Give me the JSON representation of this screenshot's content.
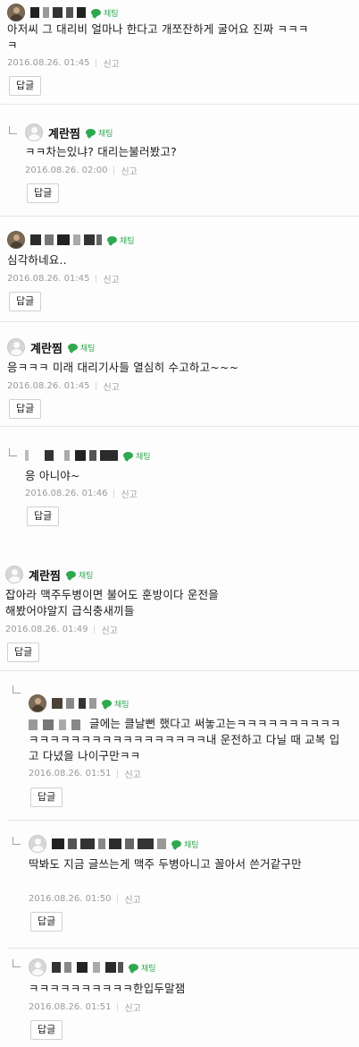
{
  "ui": {
    "chat_label": "채팅",
    "report_label": "신고",
    "reply_label": "답글"
  },
  "comments": [
    {
      "author": "",
      "text": "아저씨 그 대리비 얼마나 한다고 개쪼잔하게 굴어요 진짜 ㅋㅋㅋㅋ",
      "date": "2016.08.26. 01:45"
    },
    {
      "author": "계란찜",
      "text": "ㅋㅋ차는있냐? 대리는불러봤고?",
      "date": "2016.08.26. 02:00"
    },
    {
      "author": "",
      "text": "심각하네요..",
      "date": "2016.08.26. 01:45"
    },
    {
      "author": "계란찜",
      "text": "응ㅋㅋㅋ 미래 대리기사들 열심히 수고하고~~~",
      "date": "2016.08.26. 01:45"
    },
    {
      "author": "",
      "text": "응 아니야~",
      "date": "2016.08.26. 01:46"
    },
    {
      "author": "계란찜",
      "text": "잡아라 맥주두병이면 불어도 훈방이다 운전을 해봤어야알지 급식충새끼들",
      "date": "2016.08.26. 01:49"
    },
    {
      "author": "",
      "text": "글에는 클날뻔 했다고 써놓고는ㅋㅋㅋㅋㅋㅋㅋㅋㅋㅋㅋㅋㅋㅋㅋㅋㅋㅋㅋㅋㅋㅋㅋㅋㅋㅋㅋ내 운전하고 다닐 때 교복 입고 다녔을 나이구만ㅋㅋ",
      "date": "2016.08.26. 01:51"
    },
    {
      "author": "",
      "text": "딱봐도 지금 글쓰는게 맥주 두병아니고 꼴아서 쓴거같구만",
      "date": "2016.08.26. 01:50"
    },
    {
      "author": "",
      "text": "ㅋㅋㅋㅋㅋㅋㅋㅋㅋㅋ한입두말잼",
      "date": "2016.08.26. 01:51"
    }
  ]
}
